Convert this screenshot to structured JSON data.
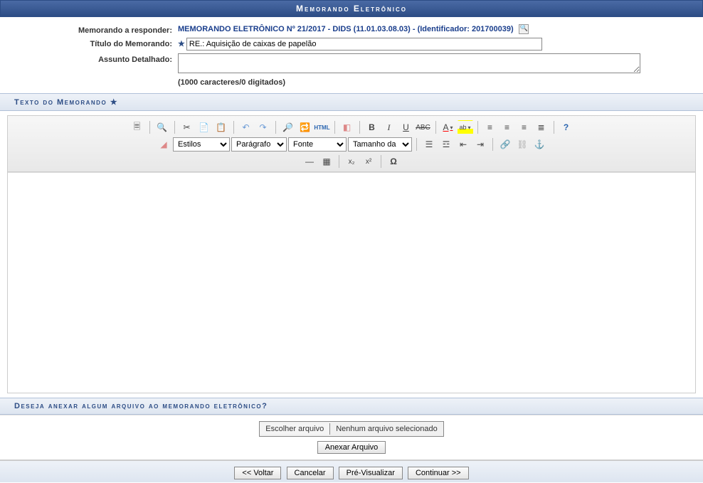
{
  "header": {
    "title": "Memorando Eletrônico"
  },
  "form": {
    "responder_label": "Memorando a responder:",
    "responder_link": "MEMORANDO ELETRÔNICO Nº 21/2017 - DIDS (11.01.03.08.03) - (Identificador: 201700039)",
    "titulo_label": "Título do Memorando:",
    "titulo_value": "RE.: Aquisição de caixas de papelão",
    "assunto_label": "Assunto Detalhado:",
    "assunto_value": "",
    "counter": "(1000 caracteres/0 digitados)"
  },
  "sections": {
    "texto": "Texto do Memorando",
    "anexar": "Deseja anexar algum arquivo ao memorando eletrônico?"
  },
  "editor_selects": {
    "estilos": "Estilos",
    "paragrafo": "Parágrafo",
    "fonte": "Fonte",
    "tamanho": "Tamanho da F"
  },
  "file": {
    "choose": "Escolher arquivo",
    "none": "Nenhum arquivo selecionado",
    "attach": "Anexar Arquivo"
  },
  "buttons": {
    "voltar": "<< Voltar",
    "cancelar": "Cancelar",
    "previsualizar": "Pré-Visualizar",
    "continuar": "Continuar >>"
  }
}
